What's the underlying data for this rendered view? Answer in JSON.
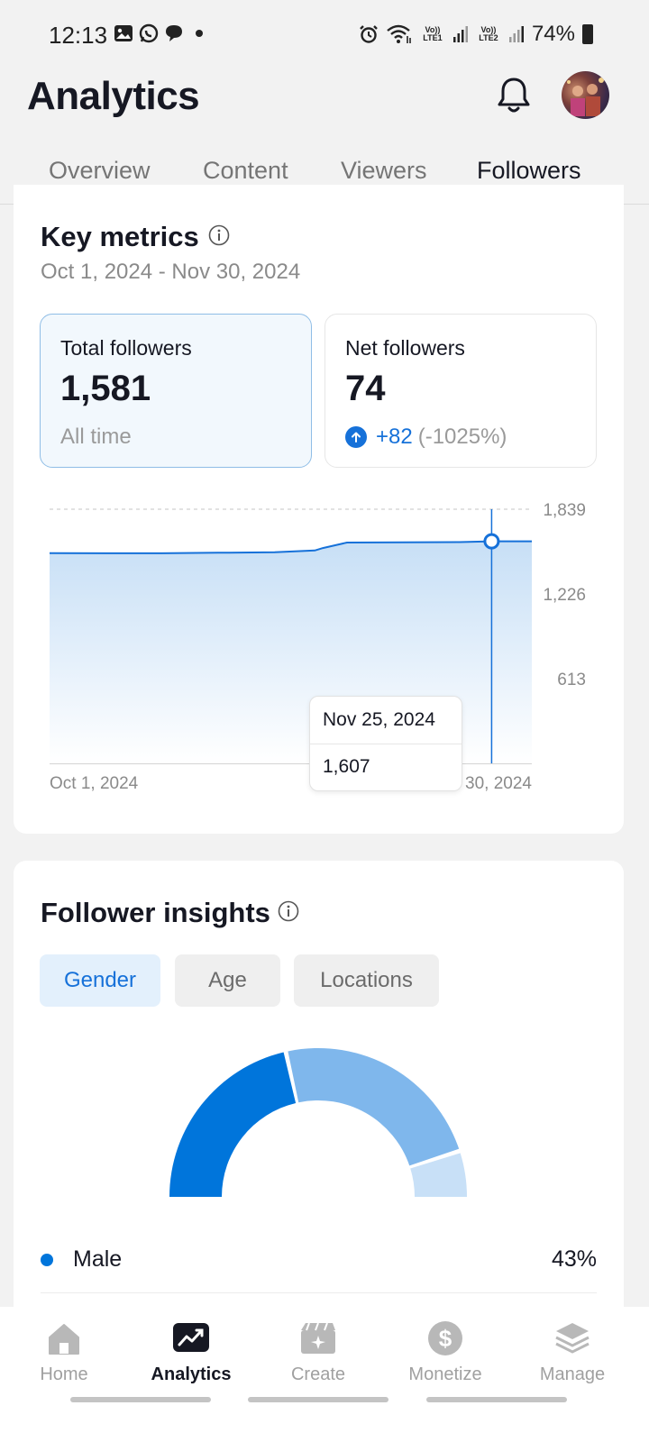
{
  "status_bar": {
    "time": "12:13",
    "battery": "74%",
    "sim1": "Vo)) LTE1",
    "sim2": "Vo)) LTE2",
    "left_icons": [
      "gallery-icon",
      "whatsapp-icon",
      "chat-icon",
      "dot-icon"
    ],
    "right_icons": [
      "alarm-icon",
      "wifi-icon",
      "signal-icon",
      "signal-icon",
      "battery-icon"
    ]
  },
  "header": {
    "title": "Analytics"
  },
  "tabs": [
    {
      "label": "Overview",
      "active": false
    },
    {
      "label": "Content",
      "active": false
    },
    {
      "label": "Viewers",
      "active": false
    },
    {
      "label": "Followers",
      "active": true
    }
  ],
  "key_metrics": {
    "title": "Key metrics",
    "date_range": "Oct 1, 2024 - Nov 30, 2024",
    "total_followers": {
      "label": "Total followers",
      "value": "1,581",
      "sub": "All time"
    },
    "net_followers": {
      "label": "Net followers",
      "value": "74",
      "delta": "+82",
      "delta_pct": "(-1025%)"
    }
  },
  "chart_data": {
    "type": "area",
    "x": [
      "Oct 1, 2024",
      "Oct 8, 2024",
      "Oct 15, 2024",
      "Oct 22, 2024",
      "Oct 29, 2024",
      "Nov 3, 2024",
      "Nov 4, 2024",
      "Nov 7, 2024",
      "Nov 14, 2024",
      "Nov 21, 2024",
      "Nov 25, 2024",
      "Nov 30, 2024"
    ],
    "y": [
      1521,
      1520,
      1520,
      1524,
      1527,
      1540,
      1558,
      1598,
      1599,
      1601,
      1607,
      1607
    ],
    "ylim": [
      0,
      1839
    ],
    "y_ticks": [
      "1,839",
      "1,226",
      "613"
    ],
    "x_tick_labels": [
      "Oct 1, 2024",
      "Nov 30, 2024"
    ],
    "grid": true,
    "tooltip": {
      "date": "Nov 25, 2024",
      "value": "1,607"
    },
    "colors": {
      "line": "#1671d9",
      "fill_top": "#c7dff6",
      "fill_bottom": "#ffffff"
    }
  },
  "insights": {
    "title": "Follower insights",
    "chips": [
      {
        "label": "Gender",
        "active": true
      },
      {
        "label": "Age",
        "active": false
      },
      {
        "label": "Locations",
        "active": false
      }
    ],
    "donut": {
      "type": "pie",
      "segments": [
        {
          "name": "Male",
          "value": 43,
          "color": "#0075db"
        },
        {
          "value": 47,
          "color": "#7fb7ec"
        },
        {
          "value": 10,
          "color": "#c8e0f7"
        }
      ]
    },
    "legend": [
      {
        "label": "Male",
        "value": "43%"
      }
    ]
  },
  "bottom_nav": [
    {
      "label": "Home",
      "icon": "home-icon",
      "active": false
    },
    {
      "label": "Analytics",
      "icon": "analytics-icon",
      "active": true
    },
    {
      "label": "Create",
      "icon": "create-icon",
      "active": false
    },
    {
      "label": "Monetize",
      "icon": "monetize-icon",
      "active": false
    },
    {
      "label": "Manage",
      "icon": "manage-icon",
      "active": false
    }
  ]
}
